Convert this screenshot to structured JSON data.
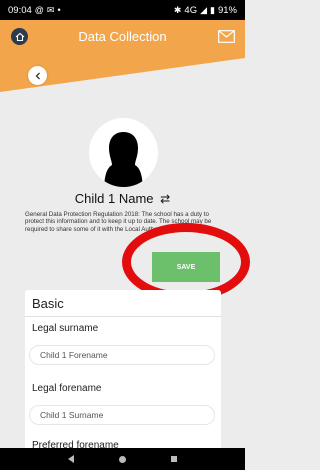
{
  "status_bar": {
    "time": "09:04",
    "left_icons": [
      "at-icon",
      "mail-icon",
      "dot-icon"
    ],
    "right_icons": [
      "bluetooth-icon",
      "signal-icon",
      "battery-icon"
    ],
    "network": "4G",
    "battery": "91%"
  },
  "header": {
    "title": "Data Collection"
  },
  "profile": {
    "name": "Child 1 Name",
    "gdpr_text": "General Data Protection Regulation 2018: The school has a duty to protect this information and to keep it up to date. The school may be required to share some of it with the Local Authority and with th"
  },
  "save": {
    "label": "SAVE"
  },
  "basic_section": {
    "title": "Basic",
    "fields": [
      {
        "label": "Legal surname",
        "value": "Child 1 Forename"
      },
      {
        "label": "Legal forename",
        "value": "Child 1 Surname"
      },
      {
        "label": "Preferred forename",
        "value": ""
      }
    ]
  },
  "colors": {
    "header_orange": "#f2a54a",
    "save_green": "#6cc06c",
    "annotation_red": "#e30d0d",
    "home_button_dark": "#2d3b4a"
  }
}
